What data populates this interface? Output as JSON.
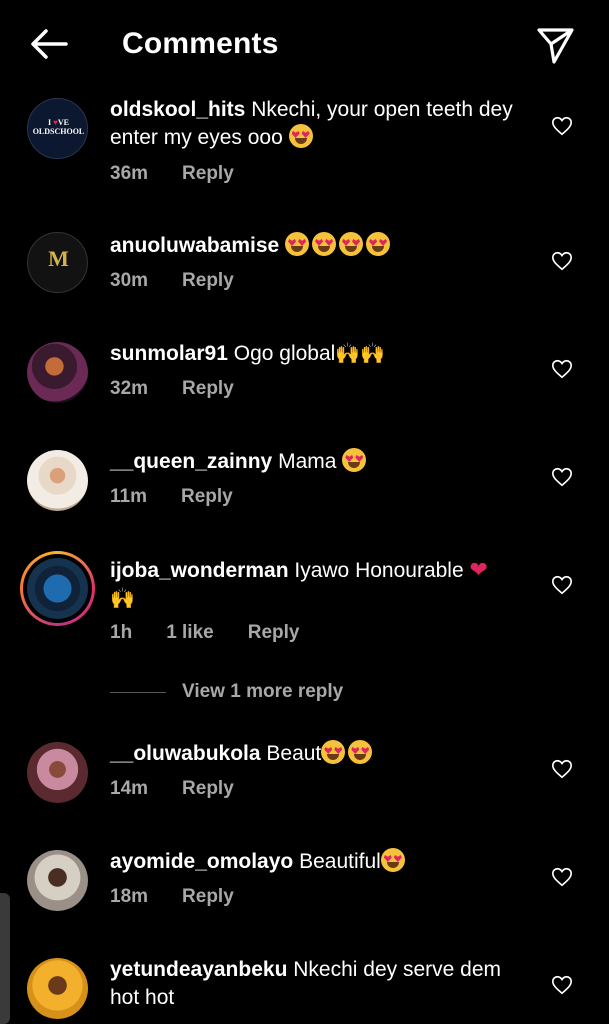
{
  "header": {
    "title": "Comments",
    "back_icon": "arrow-left-icon",
    "send_icon": "paper-plane-icon"
  },
  "comments": [
    {
      "username": "oldskool_hits",
      "text": "Nkechi, your open teeth dey enter my eyes ooo",
      "emoji": "heart-eyes-emoji",
      "time": "36m",
      "likes": "",
      "reply": "Reply",
      "avatar_text": "I LOVE OLDSCHOOL"
    },
    {
      "username": "anuoluwabamise",
      "text": "",
      "emoji": "heart-eyes-emoji x4",
      "time": "30m",
      "likes": "",
      "reply": "Reply",
      "avatar_text": "M"
    },
    {
      "username": "sunmolar91",
      "text": "Ogo global",
      "emoji": "raised-hands-emoji x2",
      "time": "32m",
      "likes": "",
      "reply": "Reply"
    },
    {
      "username": "__queen_zainny",
      "text": "Mama",
      "emoji": "heart-eyes-emoji",
      "time": "11m",
      "likes": "",
      "reply": "Reply"
    },
    {
      "username": "ijoba_wonderman",
      "text": "Iyawo Honourable",
      "emoji": "red-heart-emoji, raised-hands-emoji",
      "time": "1h",
      "likes": "1 like",
      "reply": "Reply",
      "has_story": true
    },
    {
      "username": "__oluwabukola",
      "text": "Beaut",
      "emoji": "heart-eyes-emoji x2",
      "time": "14m",
      "likes": "",
      "reply": "Reply"
    },
    {
      "username": "ayomide_omolayo",
      "text": "Beautiful",
      "emoji": "heart-eyes-emoji",
      "time": "18m",
      "likes": "",
      "reply": "Reply"
    },
    {
      "username": "yetundeayanbeku",
      "text": "Nkechi dey serve dem hot hot",
      "emoji": "",
      "time": "",
      "likes": "",
      "reply": ""
    }
  ],
  "view_more_replies": "View 1 more reply",
  "colors": {
    "background": "#000000",
    "text": "#ffffff",
    "secondary_text": "#a8a8a8",
    "emoji_face": "#f7c23b",
    "heart_red": "#e0245e"
  }
}
